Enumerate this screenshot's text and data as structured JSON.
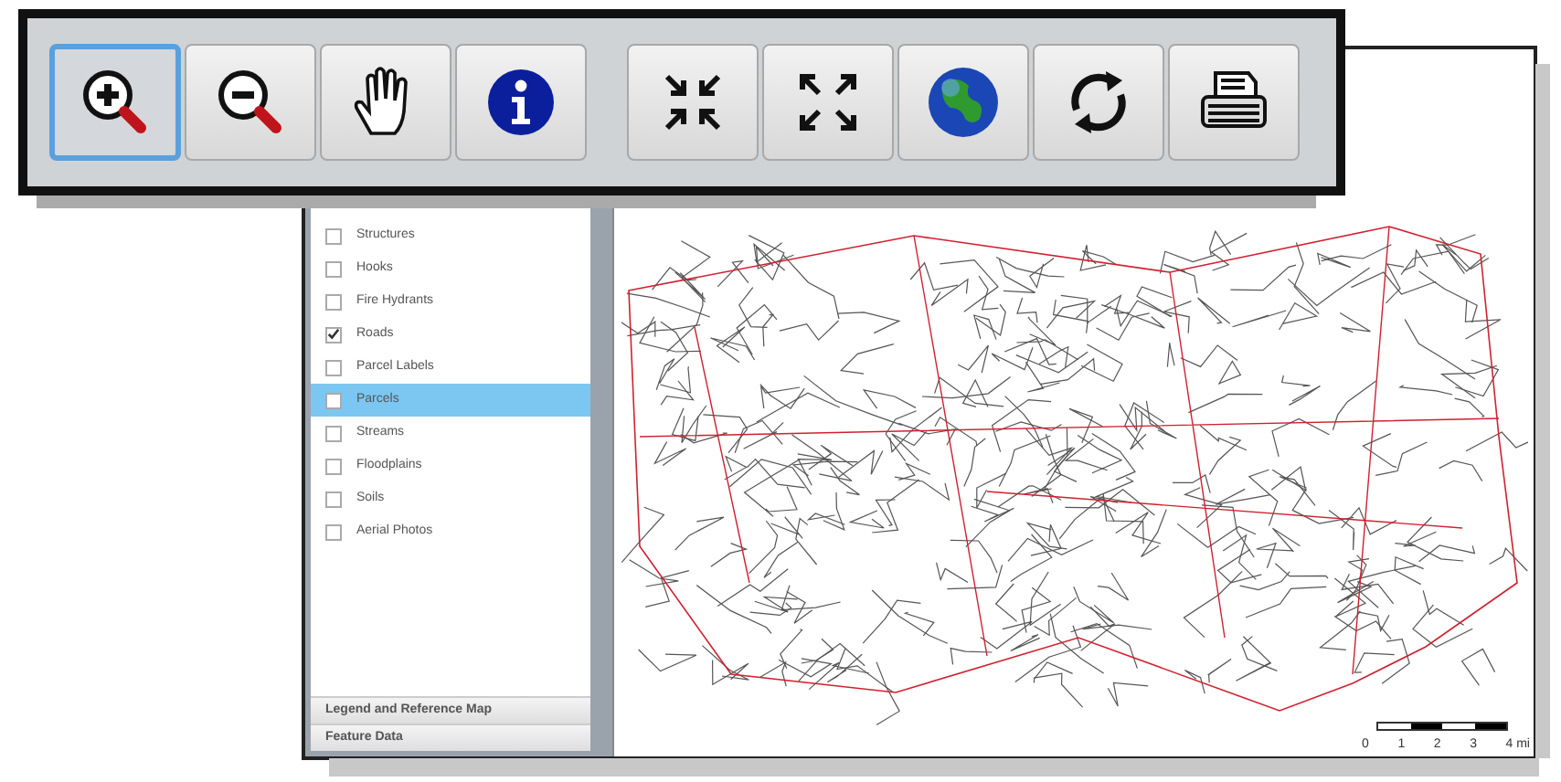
{
  "toolbar": {
    "groups": [
      [
        {
          "kind": "zoom-in",
          "selected": true
        },
        {
          "kind": "zoom-out",
          "selected": false
        },
        {
          "kind": "pan",
          "selected": false
        },
        {
          "kind": "info",
          "selected": false
        }
      ],
      [
        {
          "kind": "zoom-to-extent",
          "selected": false
        },
        {
          "kind": "full-extent",
          "selected": false
        },
        {
          "kind": "globe",
          "selected": false
        },
        {
          "kind": "refresh",
          "selected": false
        },
        {
          "kind": "print",
          "selected": false
        }
      ]
    ]
  },
  "layers": [
    {
      "label": "Structures",
      "checked": false,
      "selected": false
    },
    {
      "label": "Hooks",
      "checked": false,
      "selected": false
    },
    {
      "label": "Fire Hydrants",
      "checked": false,
      "selected": false
    },
    {
      "label": "Roads",
      "checked": true,
      "selected": false
    },
    {
      "label": "Parcel Labels",
      "checked": false,
      "selected": false
    },
    {
      "label": "Parcels",
      "checked": false,
      "selected": true
    },
    {
      "label": "Streams",
      "checked": false,
      "selected": false
    },
    {
      "label": "Floodplains",
      "checked": false,
      "selected": false
    },
    {
      "label": "Soils",
      "checked": false,
      "selected": false
    },
    {
      "label": "Aerial Photos",
      "checked": false,
      "selected": false
    }
  ],
  "panels": [
    "Legend and Reference Map",
    "Feature Data"
  ],
  "scale_bar": {
    "labels": [
      "0",
      "1",
      "2",
      "3",
      "4 mi"
    ]
  }
}
